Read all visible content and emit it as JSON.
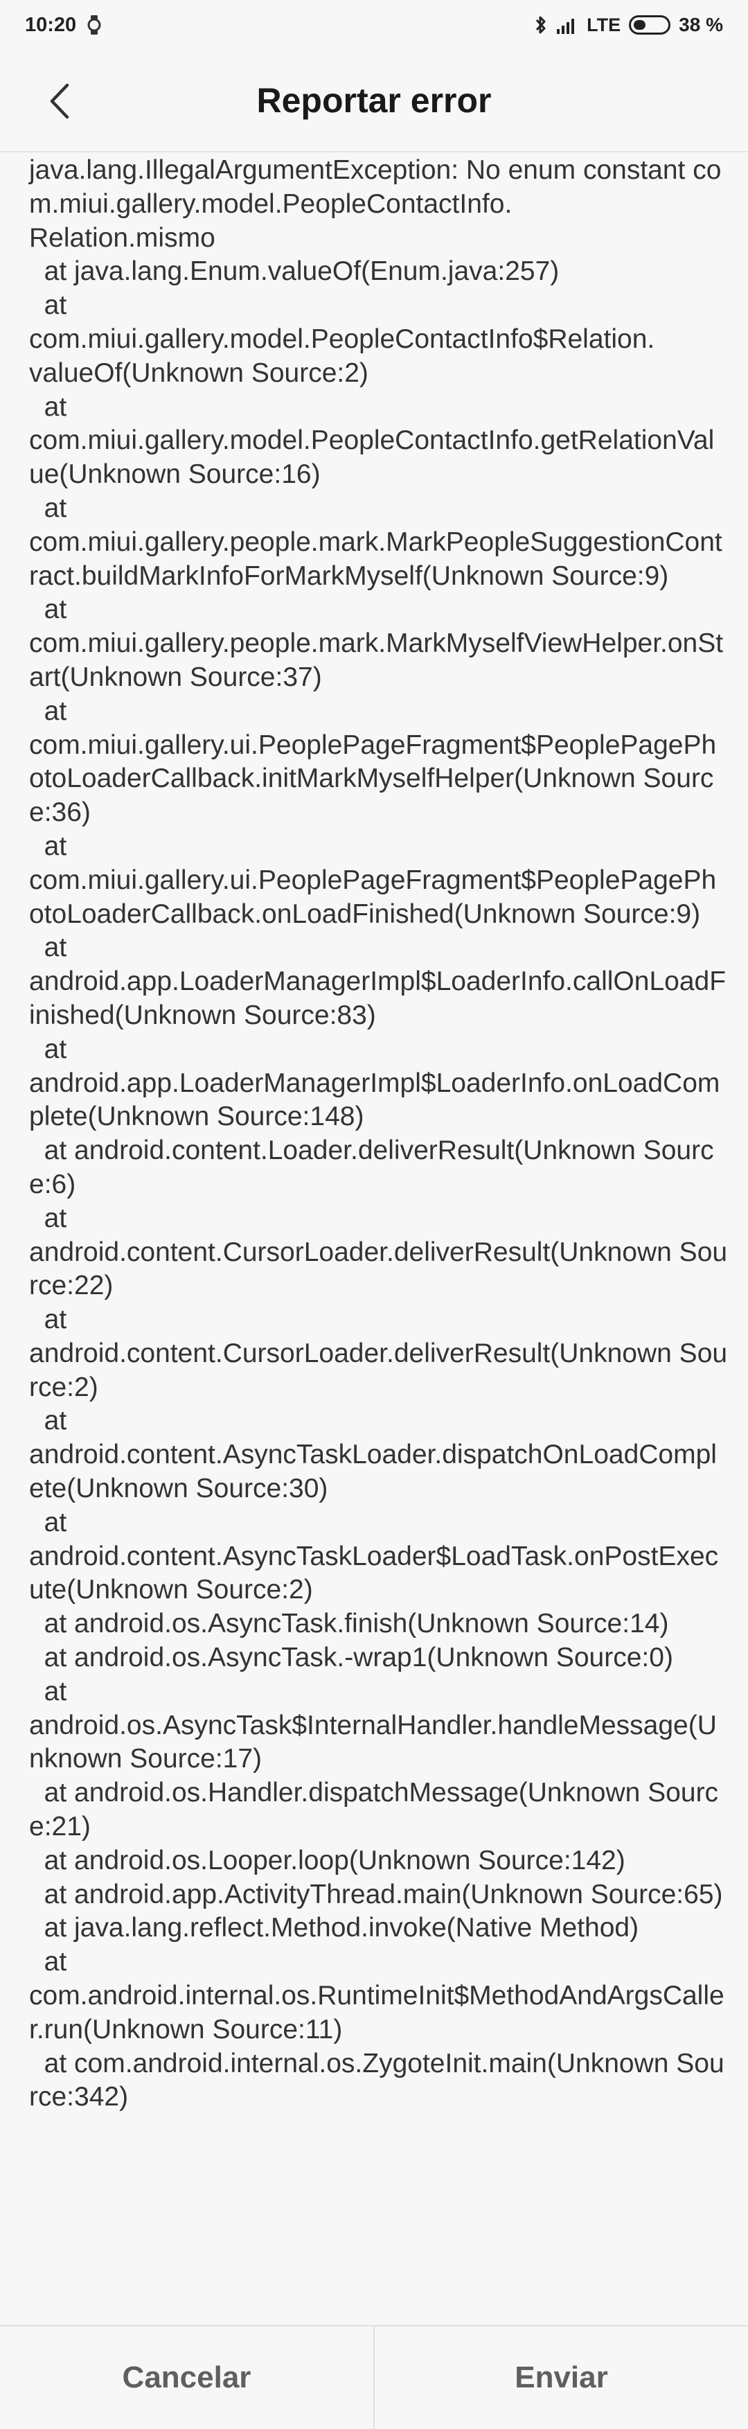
{
  "status_bar": {
    "time": "10:20",
    "left_icons": [
      "watch-icon"
    ],
    "right_icons": [
      "bluetooth-icon",
      "signal-icon",
      "battery-icon"
    ],
    "network": "LTE",
    "battery_percent_text": "38 %",
    "battery_level": 0.38
  },
  "header": {
    "title": "Reportar error",
    "back_icon": "chevron-left-icon"
  },
  "error_report": {
    "text": "java.lang.IllegalArgumentException: No enum constant com.miui.gallery.model.PeopleContactInfo.\nRelation.mismo\n  at java.lang.Enum.valueOf(Enum.java:257)\n  at\ncom.miui.gallery.model.PeopleContactInfo$Relation.\nvalueOf(Unknown Source:2)\n  at\ncom.miui.gallery.model.PeopleContactInfo.getRelationValue(Unknown Source:16)\n  at\ncom.miui.gallery.people.mark.MarkPeopleSuggestionContract.buildMarkInfoForMarkMyself(Unknown Source:9)\n  at\ncom.miui.gallery.people.mark.MarkMyselfViewHelper.onStart(Unknown Source:37)\n  at\ncom.miui.gallery.ui.PeoplePageFragment$PeoplePagePhotoLoaderCallback.initMarkMyselfHelper(Unknown Source:36)\n  at\ncom.miui.gallery.ui.PeoplePageFragment$PeoplePagePhotoLoaderCallback.onLoadFinished(Unknown Source:9)\n  at\nandroid.app.LoaderManagerImpl$LoaderInfo.callOnLoadFinished(Unknown Source:83)\n  at\nandroid.app.LoaderManagerImpl$LoaderInfo.onLoadComplete(Unknown Source:148)\n  at android.content.Loader.deliverResult(Unknown Source:6)\n  at\nandroid.content.CursorLoader.deliverResult(Unknown Source:22)\n  at\nandroid.content.CursorLoader.deliverResult(Unknown Source:2)\n  at\nandroid.content.AsyncTaskLoader.dispatchOnLoadComplete(Unknown Source:30)\n  at\nandroid.content.AsyncTaskLoader$LoadTask.onPostExecute(Unknown Source:2)\n  at android.os.AsyncTask.finish(Unknown Source:14)\n  at android.os.AsyncTask.-wrap1(Unknown Source:0)\n  at\nandroid.os.AsyncTask$InternalHandler.handleMessage(Unknown Source:17)\n  at android.os.Handler.dispatchMessage(Unknown Source:21)\n  at android.os.Looper.loop(Unknown Source:142)\n  at android.app.ActivityThread.main(Unknown Source:65)\n  at java.lang.reflect.Method.invoke(Native Method)\n  at\ncom.android.internal.os.RuntimeInit$MethodAndArgsCaller.run(Unknown Source:11)\n  at com.android.internal.os.ZygoteInit.main(Unknown Source:342)"
  },
  "actions": {
    "cancel_label": "Cancelar",
    "send_label": "Enviar"
  }
}
